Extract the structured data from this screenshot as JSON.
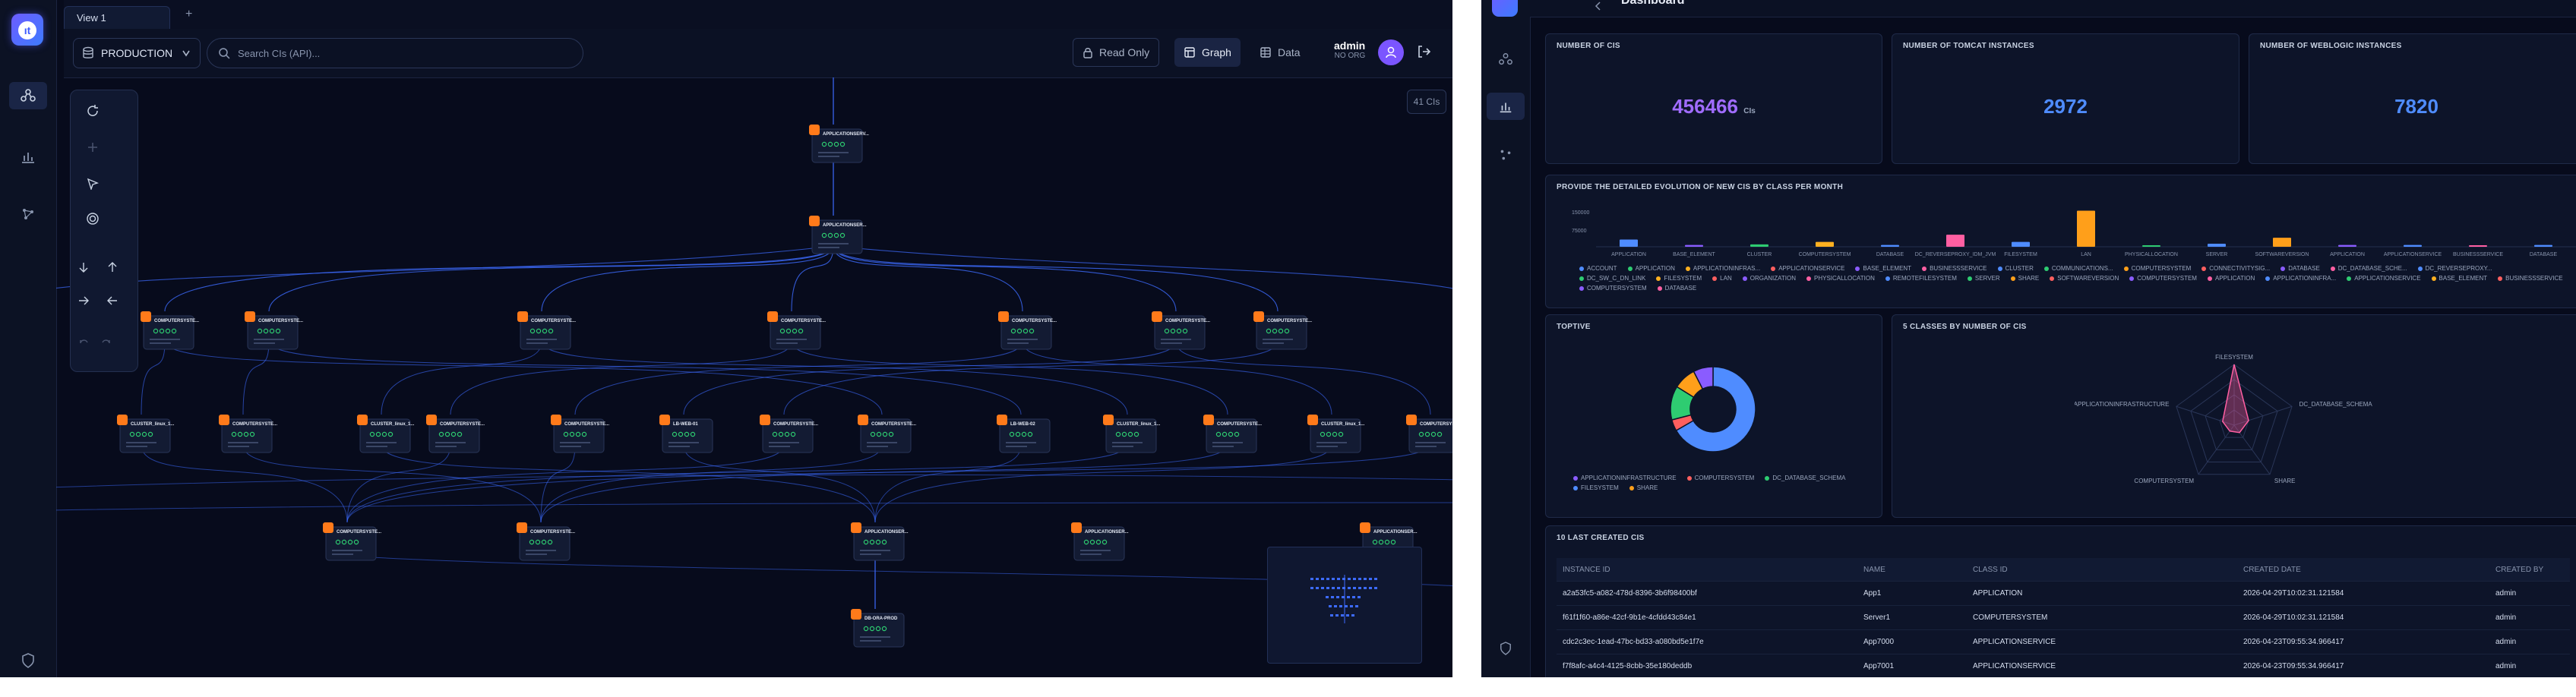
{
  "graph_app": {
    "tabs": [
      {
        "label": "View 1"
      }
    ],
    "new_tab_label": "+",
    "environment": {
      "selected": "PRODUCTION"
    },
    "search": {
      "placeholder": "Search CIs (API)..."
    },
    "buttons": {
      "read_only": "Read Only",
      "graph": "Graph",
      "data": "Data"
    },
    "user": {
      "name": "admin",
      "org": "NO ORG",
      "avatar_icon": "user-icon"
    },
    "ci_count_badge": "41 CIs",
    "colors": {
      "accent": "#7b55ff",
      "background": "#070b1c",
      "edge": "#3d6bff",
      "node_icon": "#ff7a1a",
      "node_status": "#2ecc71"
    },
    "nodes": [
      {
        "label": "APPLICATIONSERV...",
        "icon": "app-icon"
      },
      {
        "label": "APPLICATIONSER...",
        "icon": "app-icon"
      },
      {
        "label": "COMPUTERSYSTE...",
        "icon": "server-icon"
      },
      {
        "label": "COMPUTERSYSTE...",
        "icon": "server-icon"
      },
      {
        "label": "COMPUTERSYSTE...",
        "icon": "server-icon"
      },
      {
        "label": "COMPUTERSYSTE...",
        "icon": "server-icon"
      },
      {
        "label": "COMPUTERSYSTE...",
        "icon": "server-icon"
      },
      {
        "label": "COMPUTERSYSTE...",
        "icon": "server-icon"
      },
      {
        "label": "COMPUTERSYSTE...",
        "icon": "server-icon"
      },
      {
        "label": "CLUSTER_linux_1...",
        "icon": "cluster-icon"
      },
      {
        "label": "COMPUTERSYSTE...",
        "icon": "server-icon"
      },
      {
        "label": "CLUSTER_linux_1...",
        "icon": "cluster-icon"
      },
      {
        "label": "COMPUTERSYSTE...",
        "icon": "server-icon"
      },
      {
        "label": "COMPUTERSYSTE...",
        "icon": "server-icon"
      },
      {
        "label": "LB-WEB-01",
        "icon": "lb-icon"
      },
      {
        "label": "COMPUTERSYSTE...",
        "icon": "server-icon"
      },
      {
        "label": "COMPUTERSYSTE...",
        "icon": "server-icon"
      },
      {
        "label": "LB-WEB-02",
        "icon": "lb-icon"
      },
      {
        "label": "CLUSTER_linux_1...",
        "icon": "cluster-icon"
      },
      {
        "label": "COMPUTERSYSTE...",
        "icon": "server-icon"
      },
      {
        "label": "CLUSTER_linux_1...",
        "icon": "cluster-icon"
      },
      {
        "label": "COMPUTERSYSTE...",
        "icon": "server-icon"
      },
      {
        "label": "COMPUTERSYSTE...",
        "icon": "server-icon"
      },
      {
        "label": "COMPUTERSYSTE...",
        "icon": "server-icon"
      },
      {
        "label": "APPLICATIONSER...",
        "icon": "app-icon"
      },
      {
        "label": "DB-ORA-PROD",
        "icon": "db-icon"
      },
      {
        "label": "APPLICATIONSER...",
        "icon": "app-icon"
      },
      {
        "label": "APPLICATIONSER...",
        "icon": "app-icon"
      }
    ]
  },
  "dashboard": {
    "title": "Dashboard",
    "kpis": [
      {
        "title": "NUMBER OF CIS",
        "value": "456466",
        "unit": "CIs",
        "color": "#a06cff"
      },
      {
        "title": "NUMBER OF TOMCAT INSTANCES",
        "value": "2972",
        "unit": "",
        "color": "#4f8cff"
      },
      {
        "title": "NUMBER OF WEBLOGIC INSTANCES",
        "value": "7820",
        "unit": "",
        "color": "#4f8cff"
      }
    ],
    "evolution": {
      "title": "PROVIDE THE DETAILED EVOLUTION OF NEW CIS BY CLASS PER MONTH",
      "y_ticks": [
        "150000",
        "75000"
      ]
    },
    "toptive": {
      "title": "TOPTIVE"
    },
    "radar": {
      "title": "5 CLASSES BY NUMBER OF CIS"
    },
    "table": {
      "title": "10 LAST CREATED CIS",
      "columns": [
        "INSTANCE ID",
        "NAME",
        "CLASS ID",
        "CREATED DATE",
        "CREATED BY"
      ],
      "rows": [
        [
          "a2a53fc5-a082-478d-8396-3b6f98400bf",
          "App1",
          "APPLICATION",
          "2026-04-29T10:02:31.121584",
          "admin"
        ],
        [
          "f61f1f60-a86e-42cf-9b1e-4cfdd43c84e1",
          "Server1",
          "COMPUTERSYSTEM",
          "2026-04-29T10:02:31.121584",
          "admin"
        ],
        [
          "cdc2c3ec-1ead-47bc-bd33-a080bd5e1f7e",
          "App7000",
          "APPLICATIONSERVICE",
          "2026-04-23T09:55:34.966417",
          "admin"
        ],
        [
          "f7f8afc-a4c4-4125-8cbb-35e180deddb",
          "App7001",
          "APPLICATIONSERVICE",
          "2026-04-23T09:55:34.966417",
          "admin"
        ]
      ]
    }
  },
  "chart_data": [
    {
      "type": "bar",
      "title": "PROVIDE THE DETAILED EVOLUTION OF NEW CIS BY CLASS PER MONTH",
      "categories": [
        "APPLICATION",
        "BASE_ELEMENT",
        "CLUSTER",
        "COMPUTERSYSTEM",
        "DATABASE",
        "DC_REVERSEPROXY_IDM_JVM",
        "FILESYSTEM",
        "LAN",
        "PHYSICALLOCATION",
        "SERVER",
        "SOFTWAREVERSION",
        "APPLICATION",
        "APPLICATIONSERVICE",
        "BUSINESSSERVICE",
        "DATABASE"
      ],
      "values": [
        12000,
        3000,
        4000,
        8000,
        3000,
        20000,
        8000,
        60000,
        2000,
        5000,
        15000,
        3000,
        3000,
        2000,
        3000
      ],
      "colors": [
        "#4f8cff",
        "#8a5cff",
        "#2ecc71",
        "#ffb020",
        "#4f8cff",
        "#ff5fa2",
        "#4f8cff",
        "#ff9f1a",
        "#2ecc71",
        "#4f8cff",
        "#ff9f1a",
        "#8a5cff",
        "#4f8cff",
        "#ff5fa2",
        "#4f8cff"
      ],
      "ylim": [
        0,
        150000
      ],
      "legend": [
        {
          "name": "ACCOUNT",
          "color": "#4f8cff"
        },
        {
          "name": "APPLICATION",
          "color": "#2ecc71"
        },
        {
          "name": "APPLICATIONINFRAS...",
          "color": "#ffb020"
        },
        {
          "name": "APPLICATIONSERVICE",
          "color": "#ff5f5f"
        },
        {
          "name": "BASE_ELEMENT",
          "color": "#8a5cff"
        },
        {
          "name": "BUSINESSSERVICE",
          "color": "#ff5fa2"
        },
        {
          "name": "CLUSTER",
          "color": "#4f8cff"
        },
        {
          "name": "COMMUNICATIONS...",
          "color": "#2ecc71"
        },
        {
          "name": "COMPUTERSYSTEM",
          "color": "#ff9f1a"
        },
        {
          "name": "CONNECTIVITYSIG...",
          "color": "#ff5f5f"
        },
        {
          "name": "DATABASE",
          "color": "#8a5cff"
        },
        {
          "name": "DC_DATABASE_SCHE...",
          "color": "#ff5fa2"
        },
        {
          "name": "DC_REVERSEPROXY...",
          "color": "#4f8cff"
        },
        {
          "name": "DC_SW_C_DN_LINK",
          "color": "#2ecc71"
        },
        {
          "name": "FILESYSTEM",
          "color": "#ffb020"
        },
        {
          "name": "LAN",
          "color": "#ff5f5f"
        },
        {
          "name": "ORGANIZATION",
          "color": "#8a5cff"
        },
        {
          "name": "PHYSICALLOCATION",
          "color": "#ff5fa2"
        },
        {
          "name": "REMOTEFILESYSTEM",
          "color": "#4f8cff"
        },
        {
          "name": "SERVER",
          "color": "#2ecc71"
        },
        {
          "name": "SHARE",
          "color": "#ff9f1a"
        },
        {
          "name": "SOFTWAREVERSION",
          "color": "#ff5f5f"
        },
        {
          "name": "COMPUTERSYSTEM",
          "color": "#8a5cff"
        },
        {
          "name": "APPLICATION",
          "color": "#ff5fa2"
        },
        {
          "name": "APPLICATIONINFRA...",
          "color": "#4f8cff"
        },
        {
          "name": "APPLICATIONSERVICE",
          "color": "#2ecc71"
        },
        {
          "name": "BASE_ELEMENT",
          "color": "#ffb020"
        },
        {
          "name": "BUSINESSSERVICE",
          "color": "#ff5f5f"
        },
        {
          "name": "COMPUTERSYSTEM",
          "color": "#8a5cff"
        },
        {
          "name": "DATABASE",
          "color": "#ff5fa2"
        }
      ]
    },
    {
      "type": "pie",
      "title": "TOPTIVE",
      "slices": [
        {
          "name": "APPLICATIONINFRASTRUCTURE",
          "value": 62,
          "color": "#4f8cff"
        },
        {
          "name": "COMPUTERSYSTEM",
          "value": 4,
          "color": "#ff5f5f"
        },
        {
          "name": "DC_DATABASE_SCHEMA",
          "value": 12,
          "color": "#2ecc71"
        },
        {
          "name": "FILESYSTEM",
          "value": 8,
          "color": "#ff9f1a"
        },
        {
          "name": "SHARE",
          "value": 7,
          "color": "#8a5cff"
        }
      ],
      "legend": [
        {
          "name": "APPLICATIONINFRASTRUCTURE",
          "color": "#8a5cff"
        },
        {
          "name": "COMPUTERSYSTEM",
          "color": "#ff5f5f"
        },
        {
          "name": "DC_DATABASE_SCHEMA",
          "color": "#2ecc71"
        },
        {
          "name": "FILESYSTEM",
          "color": "#4f8cff"
        },
        {
          "name": "SHARE",
          "color": "#ff9f1a"
        }
      ]
    },
    {
      "type": "radar",
      "title": "5 CLASSES BY NUMBER OF CIS",
      "axes": [
        "FILESYSTEM",
        "DC_DATABASE_SCHEMA",
        "SHARE",
        "COMPUTERSYSTEM",
        "APPLICATIONINFRASTRUCTURE"
      ],
      "values": [
        1.0,
        0.25,
        0.15,
        0.12,
        0.2
      ],
      "color": "#ff5fa2"
    }
  ]
}
